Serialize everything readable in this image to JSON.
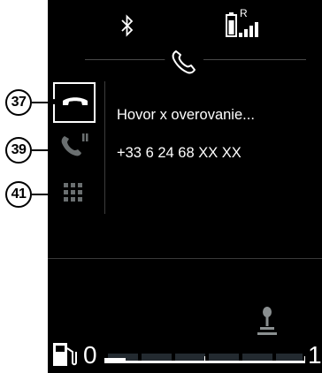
{
  "status_bar": {
    "bluetooth_icon": "bluetooth-icon",
    "battery_icon": "phone-battery-icon",
    "roaming_indicator": "R",
    "signal_icon": "signal-bars-icon"
  },
  "call": {
    "status_text": "Hovor x overovanie...",
    "number": "+33 6 24 68 XX XX",
    "handset_icon": "phone-handset-icon"
  },
  "controls": {
    "hangup": {
      "callout": "37",
      "icon": "hang-up-icon"
    },
    "hold": {
      "callout": "39",
      "icon": "call-hold-icon"
    },
    "keypad": {
      "callout": "41",
      "icon": "keypad-icon"
    }
  },
  "footer": {
    "fuel_icon": "fuel-pump-icon",
    "gauge_min": "0",
    "gauge_max": "1",
    "gear_icon": "gear-shift-icon"
  },
  "colors": {
    "screen_bg": "#000000",
    "foreground": "#ffffff",
    "dim_icon": "#6a6f70",
    "divider": "#3a3a3a"
  }
}
